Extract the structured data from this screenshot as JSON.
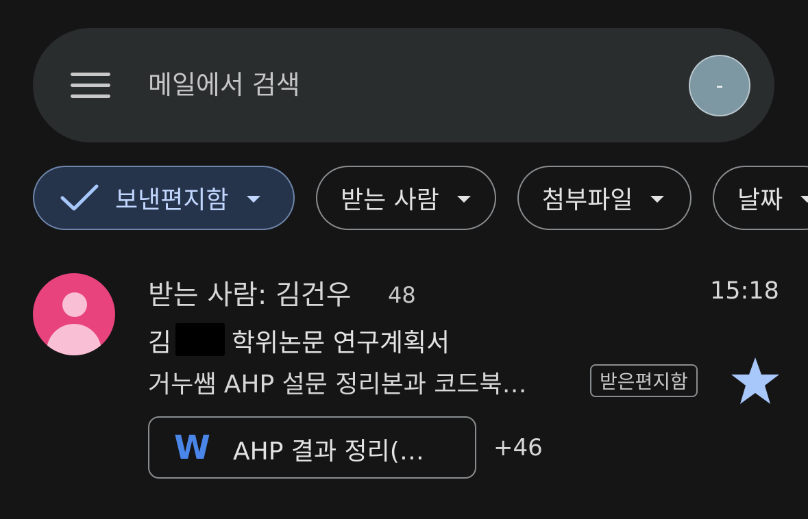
{
  "search": {
    "placeholder": "메일에서 검색",
    "account_initial": "-"
  },
  "filters": {
    "chips": [
      {
        "label": "보낸편지함",
        "selected": true
      },
      {
        "label": "받는 사람",
        "selected": false
      },
      {
        "label": "첨부파일",
        "selected": false
      },
      {
        "label": "날짜",
        "selected": false
      }
    ]
  },
  "email": {
    "recipient": "받는 사람: 김건우",
    "thread_count": "48",
    "time": "15:18",
    "subject_prefix": "김",
    "subject_rest": "학위논문 연구계획서",
    "snippet": "거누쌤 AHP 설문 정리본과 코드북…",
    "label": "받은편지함",
    "starred": true,
    "attachment": {
      "name": "AHP 결과 정리(…",
      "icon_letter": "W"
    },
    "more_attachments": "+46"
  },
  "colors": {
    "background": "#151516",
    "search_bar": "#2a2d2e",
    "selected_chip": "#26344b",
    "selected_chip_text": "#c2d7ff",
    "avatar": "#e8437c",
    "star": "#a8c7fa",
    "word_icon": "#4a86e8"
  }
}
